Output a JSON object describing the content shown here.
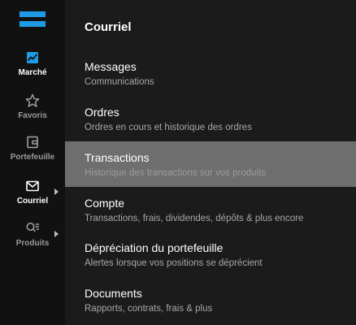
{
  "sidebar": {
    "items": [
      {
        "label": "Marché",
        "icon": "chart-icon",
        "active": true
      },
      {
        "label": "Favoris",
        "icon": "star-icon",
        "active": false
      },
      {
        "label": "Portefeuille",
        "icon": "wallet-icon",
        "active": false
      },
      {
        "label": "Courriel",
        "icon": "envelope-icon",
        "active": false,
        "expanded_arrow": true
      },
      {
        "label": "Produits",
        "icon": "search-list-icon",
        "active": false,
        "expanded_arrow": true
      }
    ]
  },
  "panel": {
    "title": "Courriel",
    "items": [
      {
        "title": "Messages",
        "subtitle": "Communications"
      },
      {
        "title": "Ordres",
        "subtitle": "Ordres en cours et historique des ordres"
      },
      {
        "title": "Transactions",
        "subtitle": "Historique des transactions sur vos produits",
        "selected": true
      },
      {
        "title": "Compte",
        "subtitle": "Transactions, frais, dividendes, dépôts & plus encore"
      },
      {
        "title": "Dépréciation du portefeuille",
        "subtitle": "Alertes lorsque vos positions se déprécient"
      },
      {
        "title": "Documents",
        "subtitle": "Rapports, contrats, frais & plus"
      }
    ]
  },
  "colors": {
    "brand": "#1f9be6",
    "sidebar_bg": "#111111",
    "panel_bg": "#1b1b1b",
    "selected_bg": "#6e6e6e"
  }
}
